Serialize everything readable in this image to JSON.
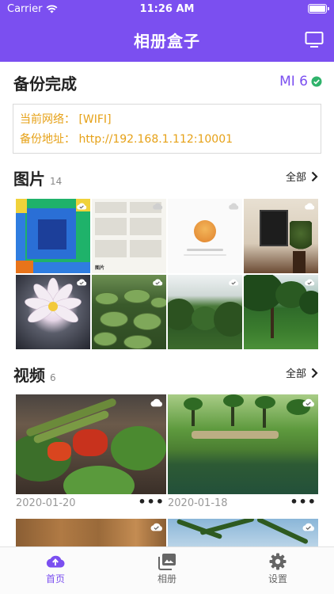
{
  "status_bar": {
    "carrier": "Carrier",
    "time": "11:26 AM"
  },
  "header": {
    "title": "相册盒子",
    "right_icon": "tv-icon"
  },
  "backup": {
    "title": "备份完成",
    "device": "MI 6",
    "network": "当前网络：  [WIFI]",
    "address": "备份地址：  http://192.168.1.112:10001"
  },
  "photos": {
    "title": "图片",
    "count": "14",
    "all_label": "全部",
    "thumb_text": {
      "doc_label": "图片"
    }
  },
  "videos": {
    "title": "视频",
    "count": "6",
    "all_label": "全部",
    "items": [
      {
        "date": "2020-01-20",
        "more": "•••"
      },
      {
        "date": "2020-01-18",
        "more": "•••"
      }
    ]
  },
  "tabs": [
    {
      "label": "首页",
      "icon": "cloud-upload-icon",
      "active": true
    },
    {
      "label": "相册",
      "icon": "photo-album-icon",
      "active": false
    },
    {
      "label": "设置",
      "icon": "gear-icon",
      "active": false
    }
  ],
  "colors": {
    "accent": "#7b4ff0",
    "info_text": "#e6a117"
  }
}
